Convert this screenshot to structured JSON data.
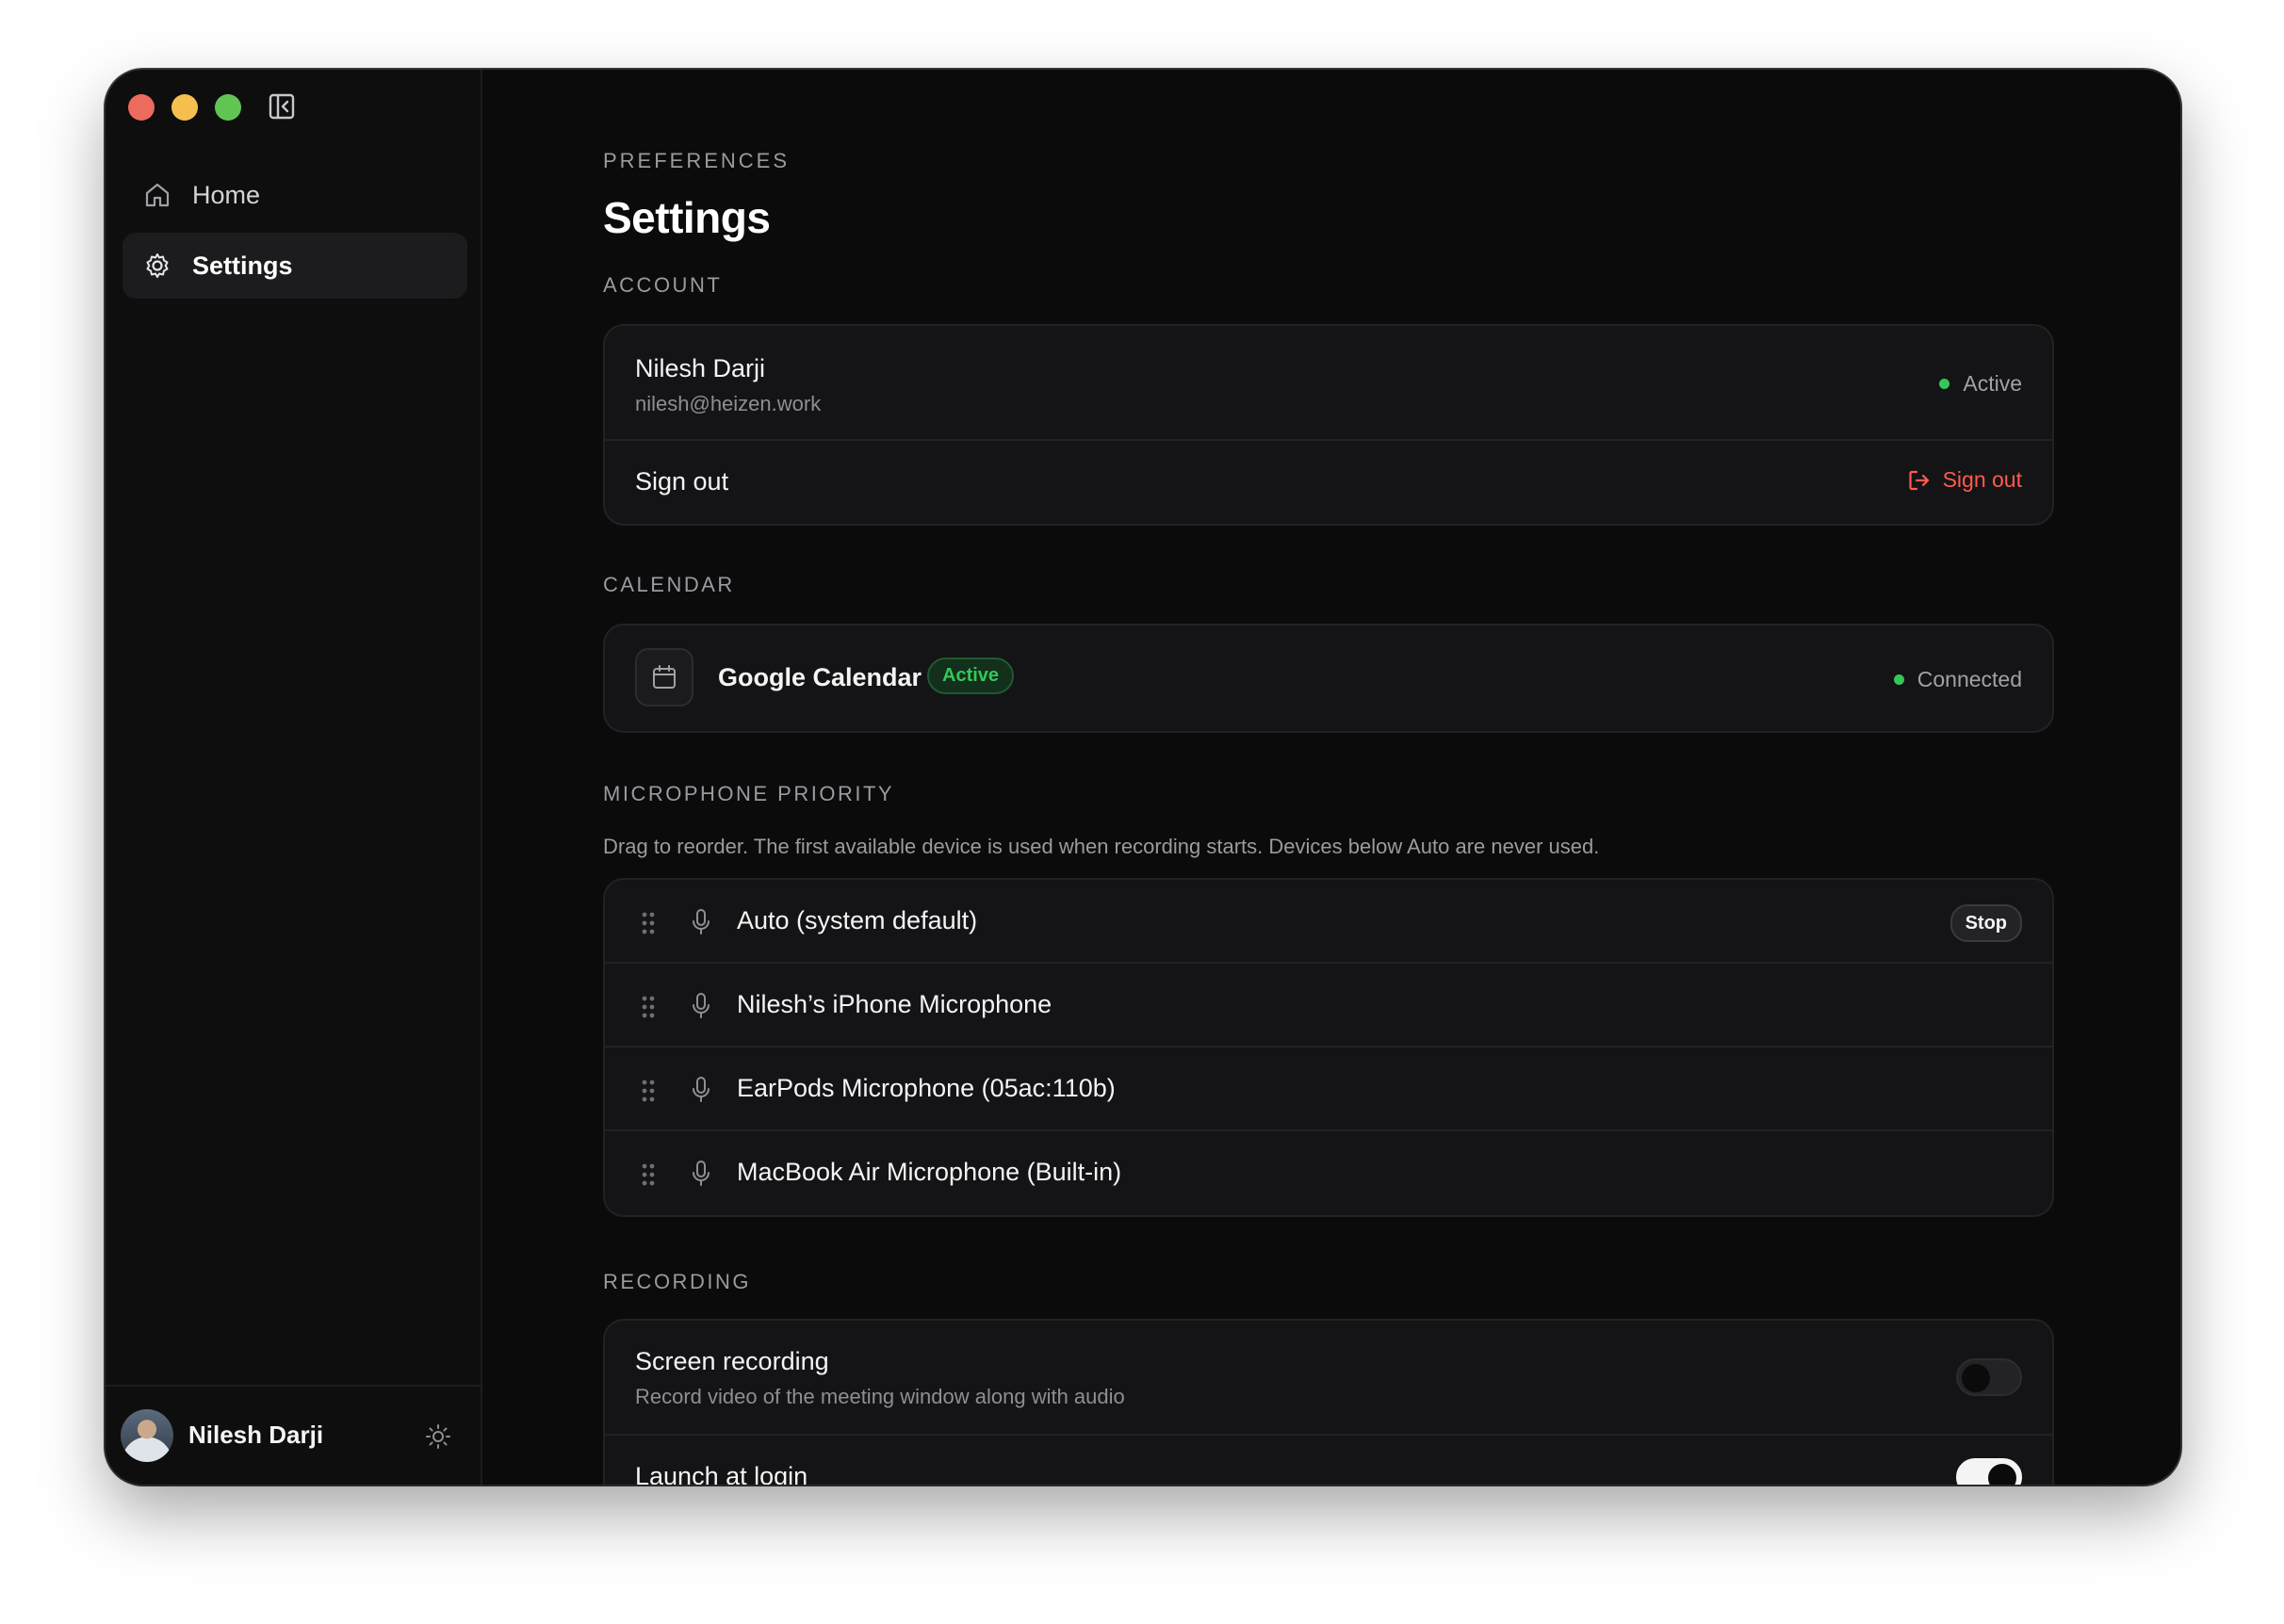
{
  "sidebar": {
    "items": [
      {
        "label": "Home",
        "icon": "home-icon"
      },
      {
        "label": "Settings",
        "icon": "gear-icon",
        "active": true
      }
    ],
    "user": {
      "name": "Nilesh Darji"
    }
  },
  "header": {
    "eyebrow": "PREFERENCES",
    "title": "Settings"
  },
  "account": {
    "section_label": "ACCOUNT",
    "name": "Nilesh Darji",
    "email": "nilesh@heizen.work",
    "status": "Active",
    "signout_row_label": "Sign out",
    "signout_button": "Sign out"
  },
  "calendar": {
    "section_label": "CALENDAR",
    "name": "Google Calendar",
    "badge": "Active",
    "status": "Connected"
  },
  "microphone": {
    "section_label": "MICROPHONE PRIORITY",
    "description": "Drag to reorder. The first available device is used when recording starts. Devices below Auto are never used.",
    "devices": [
      {
        "label": "Auto (system default)",
        "action": "Stop"
      },
      {
        "label": "Nilesh’s iPhone Microphone"
      },
      {
        "label": "EarPods Microphone (05ac:110b)"
      },
      {
        "label": "MacBook Air Microphone (Built-in)"
      }
    ]
  },
  "recording": {
    "section_label": "RECORDING",
    "items": [
      {
        "title": "Screen recording",
        "subtitle": "Record video of the meeting window along with audio",
        "enabled": false
      },
      {
        "title": "Launch at login",
        "enabled": true
      }
    ]
  },
  "colors": {
    "background": "#0b0b0c",
    "card": "#141416",
    "status_green": "#34c759",
    "danger": "#ff5a4f"
  }
}
